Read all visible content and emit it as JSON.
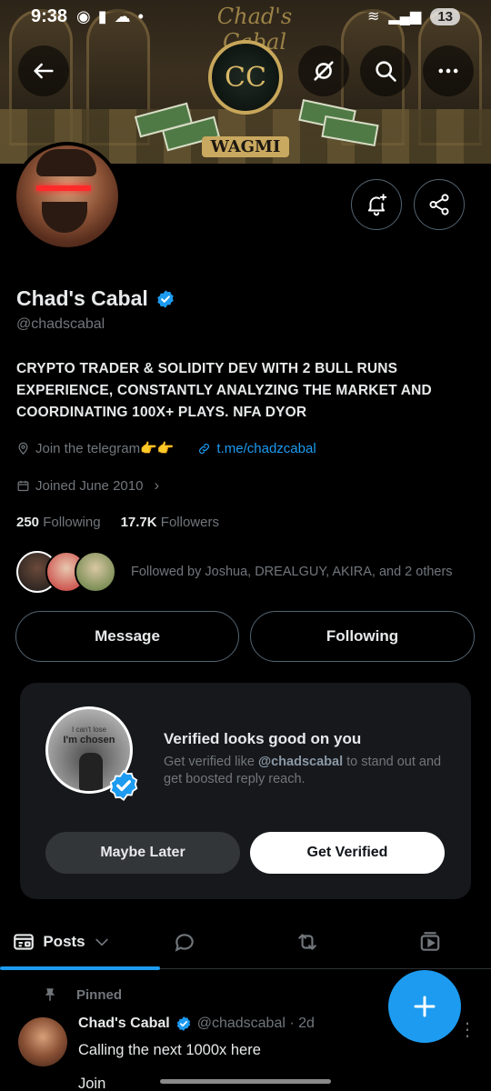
{
  "status_bar": {
    "time": "9:38",
    "battery": "13"
  },
  "banner": {
    "title": "Chad's Cabal",
    "logo_text": "CC",
    "tagline": "WAGMI"
  },
  "profile": {
    "name": "Chad's Cabal",
    "handle": "@chadscabal",
    "bio": "CRYPTO TRADER & SOLIDITY DEV WITH 2 BULL RUNS EXPERIENCE, CONSTANTLY ANALYZING THE MARKET AND COORDINATING 100X+ PLAYS. NFA DYOR",
    "location": "Join the telegram👉👉",
    "link": "t.me/chadzcabal",
    "joined": "Joined June 2010",
    "following_count": "250",
    "following_label": "Following",
    "followers_count": "17.7K",
    "followers_label": "Followers",
    "followed_by": "Followed by Joshua, DREALGUY, AKIRA, and 2 others",
    "verified_color": "#1d9bf0"
  },
  "actions": {
    "message": "Message",
    "following": "Following"
  },
  "verified_card": {
    "image_line1": "I can't lose",
    "image_line2": "I'm chosen",
    "title": "Verified looks good on you",
    "desc_prefix": "Get verified like ",
    "desc_handle": "@chadscabal",
    "desc_suffix": " to stand out and get boosted reply reach.",
    "later": "Maybe Later",
    "verify": "Get Verified"
  },
  "tabs": {
    "posts": "Posts"
  },
  "pinned_post": {
    "pinned_label": "Pinned",
    "author": "Chad's Cabal",
    "handle_time": "@chadscabal · 2d",
    "text": "Calling the next 1000x here",
    "text2": "Join"
  },
  "colors": {
    "accent": "#1d9bf0",
    "background": "#000000",
    "muted": "#71767b"
  }
}
